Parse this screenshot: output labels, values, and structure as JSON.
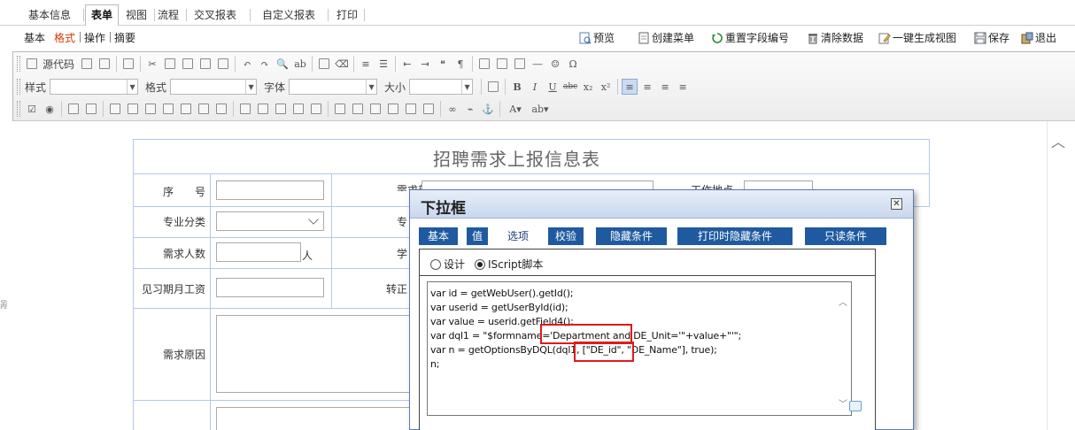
{
  "tabs": [
    "基本信息",
    "表单",
    "视图",
    "流程",
    "交叉报表",
    "自定义报表",
    "打印"
  ],
  "active_tab": "表单",
  "subnav": [
    "基本",
    "格式",
    "操作",
    "摘要"
  ],
  "active_subnav": "格式",
  "actions": [
    {
      "label": "预览",
      "icon": "preview-icon"
    },
    {
      "label": "创建菜单",
      "icon": "create-menu-icon"
    },
    {
      "label": "重置字段编号",
      "icon": "reset-icon"
    },
    {
      "label": "清除数据",
      "icon": "trash-icon"
    },
    {
      "label": "一键生成视图",
      "icon": "generate-view-icon"
    },
    {
      "label": "保存",
      "icon": "save-icon"
    },
    {
      "label": "退出",
      "icon": "exit-icon"
    }
  ],
  "toolbar": {
    "source_label": "源代码",
    "style_label": "样式",
    "format_label": "格式",
    "font_label": "字体",
    "size_label": "大小",
    "bold": "B",
    "italic": "I",
    "underline": "U",
    "strike": "abc",
    "subscript": "x₂",
    "superscript": "x²",
    "omega": "Ω"
  },
  "form": {
    "title": "招聘需求上报信息表",
    "labels": {
      "seq": "序　　号",
      "dept_partial": "需求部门",
      "location_partial": "工作地点",
      "major_class": "专业分类",
      "major_partial": "专",
      "headcount": "需求人数",
      "person_unit": "人",
      "edu_partial": "学",
      "intern_salary": "见习期月工资",
      "regular_partial": "转正",
      "reason": "需求原因"
    }
  },
  "dialog": {
    "title": "下拉框",
    "close": "⊠",
    "tabs": [
      "基本",
      "值",
      "选项",
      "校验",
      "隐藏条件",
      "打印时隐藏条件",
      "只读条件"
    ],
    "active_tab": "选项",
    "modes": [
      {
        "label": "设计",
        "checked": false
      },
      {
        "label": "IScript脚本",
        "checked": true
      }
    ],
    "code_lines": [
      "var id = getWebUser().getId();",
      "var userid = getUserById(id);",
      "var value = userid.getField4();",
      "var dql1 = \"$formname='Department and DE_Unit='\"+value+\"'\";",
      "var n = getOptionsByDQL(dql1, [\"DE_id\", \"DE_Name\"], true);",
      "n;"
    ]
  },
  "left_edge_char": "剐"
}
